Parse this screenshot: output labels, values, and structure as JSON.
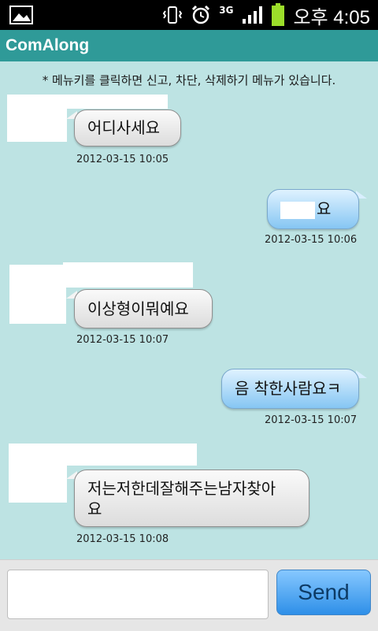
{
  "statusbar": {
    "network": "3G",
    "time": "오후 4:05",
    "icons": [
      "image-icon",
      "vibrate-icon",
      "alarm-icon",
      "signal-icon",
      "battery-icon"
    ]
  },
  "app": {
    "title": "ComAlong"
  },
  "notice": "* 메뉴키를 클릭하면 신고, 차단, 삭제하기 메뉴가 있습니다.",
  "messages": [
    {
      "direction": "in",
      "text": "어디사세요",
      "time": "2012-03-15 10:05"
    },
    {
      "direction": "out",
      "text": "요",
      "time": "2012-03-15 10:06"
    },
    {
      "direction": "in",
      "text": "이상형이뭐예요",
      "time": "2012-03-15 10:07"
    },
    {
      "direction": "out",
      "text": "음 착한사람요ㅋ",
      "time": "2012-03-15 10:07"
    },
    {
      "direction": "in",
      "text_line1": "저는저한데잘해주는남자찾아",
      "text_line2": "요",
      "time": "2012-03-15 10:08"
    }
  ],
  "composer": {
    "input_value": "",
    "send_label": "Send"
  },
  "colors": {
    "background": "#bde3e3",
    "titlebar": "#2f9a98",
    "send": "#2e8fe8"
  }
}
